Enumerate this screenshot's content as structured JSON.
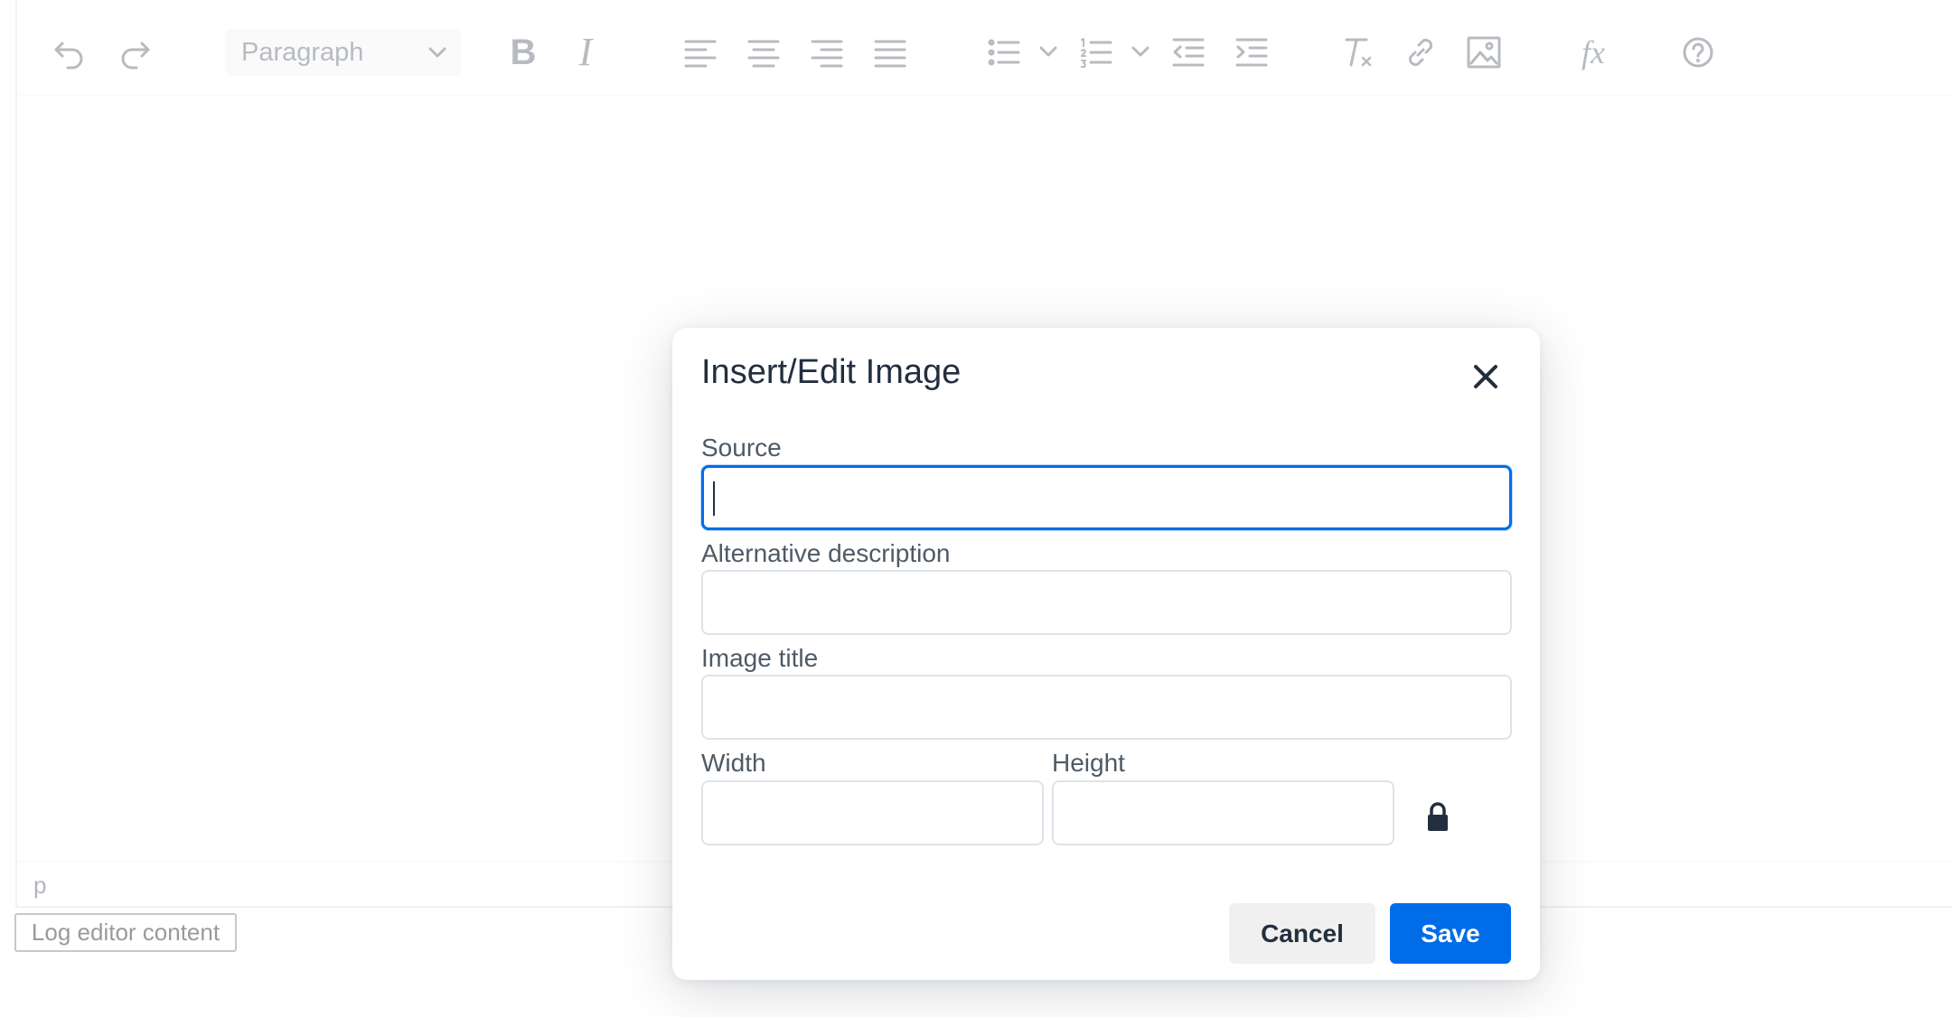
{
  "toolbar": {
    "block_format": "Paragraph",
    "buttons": [
      {
        "name": "undo-icon"
      },
      {
        "name": "redo-icon"
      },
      {
        "name": "bold-icon",
        "glyph": "B"
      },
      {
        "name": "italic-icon",
        "glyph": "I"
      },
      {
        "name": "align-left-icon"
      },
      {
        "name": "align-center-icon"
      },
      {
        "name": "align-right-icon"
      },
      {
        "name": "align-justify-icon"
      },
      {
        "name": "bullet-list-icon"
      },
      {
        "name": "numbered-list-icon"
      },
      {
        "name": "outdent-icon"
      },
      {
        "name": "indent-icon"
      },
      {
        "name": "clear-formatting-icon"
      },
      {
        "name": "link-icon"
      },
      {
        "name": "image-icon"
      },
      {
        "name": "formula-icon",
        "glyph": "fx"
      },
      {
        "name": "help-icon"
      }
    ]
  },
  "statusbar": {
    "path": "p"
  },
  "log_button": {
    "label": "Log editor content"
  },
  "dialog": {
    "title": "Insert/Edit Image",
    "fields": {
      "source": {
        "label": "Source",
        "value": ""
      },
      "alt": {
        "label": "Alternative description",
        "value": ""
      },
      "title": {
        "label": "Image title",
        "value": ""
      },
      "width": {
        "label": "Width",
        "value": ""
      },
      "height": {
        "label": "Height",
        "value": ""
      }
    },
    "cancel_label": "Cancel",
    "save_label": "Save"
  },
  "colors": {
    "accent": "#006ce7",
    "text": "#222f3e",
    "label": "#4e5a66",
    "border": "#dfe3e8",
    "cancel_bg": "#f0f0f0"
  }
}
